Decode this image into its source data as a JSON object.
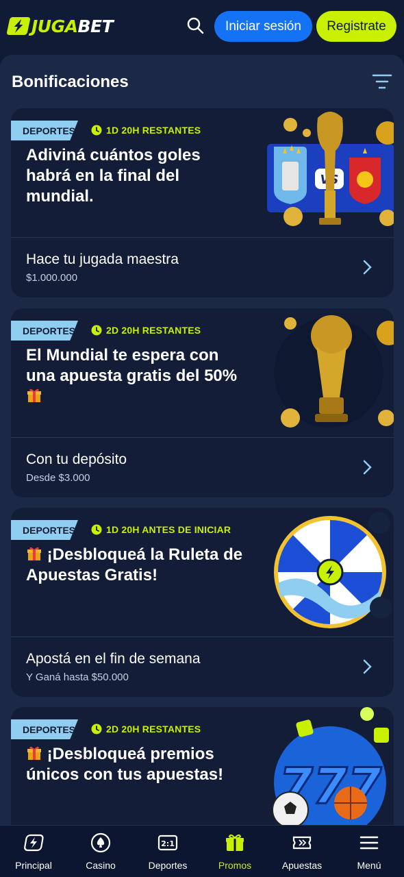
{
  "header": {
    "logo_part1": "JUGA",
    "logo_part2": "BET",
    "login_label": "Iniciar sesión",
    "register_label": "Registrate"
  },
  "page": {
    "title": "Bonificaciones"
  },
  "cards": [
    {
      "badge": "DEPORTES",
      "timer": "1D 20H RESTANTES",
      "title": "Adiviná cuántos goles habrá en la final del mundial.",
      "subtitle": "Hace tu jugada maestra",
      "subtext": "$1.000.000"
    },
    {
      "badge": "DEPORTES",
      "timer": "2D 20H RESTANTES",
      "title": "El Mundial te espera con una apuesta gratis del 50%",
      "subtitle": "Con tu depósito",
      "subtext": "Desde $3.000"
    },
    {
      "badge": "DEPORTES",
      "timer": "1D 20H ANTES DE INICIAR",
      "title": "¡Desbloqueá la Ruleta de Apuestas Gratis!",
      "subtitle": "Apostá en el fin de semana",
      "subtext": "Y Ganá hasta $50.000"
    },
    {
      "badge": "DEPORTES",
      "timer": "2D 20H RESTANTES",
      "title": "¡Desbloqueá premios únicos con tus apuestas!"
    }
  ],
  "nav": [
    {
      "label": "Principal",
      "icon": "bolt-icon"
    },
    {
      "label": "Casino",
      "icon": "spade-icon"
    },
    {
      "label": "Deportes",
      "icon": "scoreboard-icon"
    },
    {
      "label": "Promos",
      "icon": "gift-icon",
      "active": true
    },
    {
      "label": "Apuestas",
      "icon": "ticket-icon"
    },
    {
      "label": "Menú",
      "icon": "hamburger-icon"
    }
  ],
  "colors": {
    "accent_lime": "#c8f000",
    "primary_blue": "#1473f4",
    "badge_blue": "#8fcdf1",
    "background": "#0f1a33",
    "card": "#131d38"
  }
}
